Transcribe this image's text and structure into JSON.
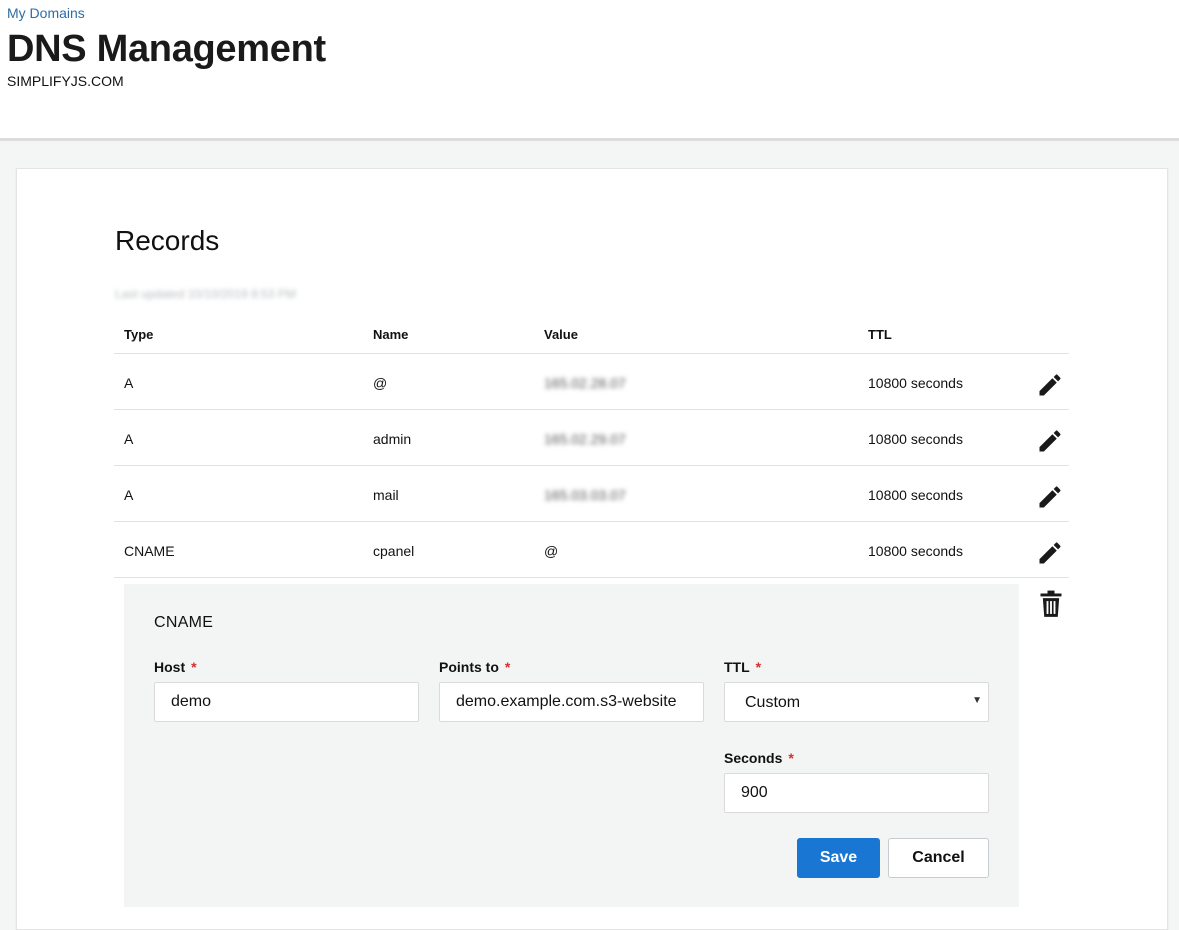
{
  "header": {
    "breadcrumb": "My Domains",
    "title": "DNS Management",
    "domain": "SIMPLIFYJS.COM"
  },
  "records": {
    "heading": "Records",
    "last_updated": "Last updated 10/10/2019 8:53 PM",
    "columns": [
      "Type",
      "Name",
      "Value",
      "TTL"
    ],
    "rows": [
      {
        "type": "A",
        "name": "@",
        "value": "165.02.28.07",
        "ttl": "10800 seconds"
      },
      {
        "type": "A",
        "name": "admin",
        "value": "165.02.29.07",
        "ttl": "10800 seconds"
      },
      {
        "type": "A",
        "name": "mail",
        "value": "165.03.03.07",
        "ttl": "10800 seconds"
      },
      {
        "type": "CNAME",
        "name": "cpanel",
        "value": "@",
        "ttl": "10800 seconds"
      }
    ]
  },
  "editor": {
    "record_type": "CNAME",
    "host_label": "Host",
    "host_value": "demo",
    "points_to_label": "Points to",
    "points_to_value": "demo.example.com.s3-website",
    "ttl_label": "TTL",
    "ttl_value": "Custom",
    "seconds_label": "Seconds",
    "seconds_value": "900",
    "required_mark": "*",
    "save_label": "Save",
    "cancel_label": "Cancel"
  },
  "icons": {
    "edit": "pencil-icon",
    "delete": "trash-icon",
    "select_caret": "caret-down-icon"
  },
  "colors": {
    "link": "#2d6ea8",
    "primary_button": "#1976d2",
    "required": "#d32f2f",
    "panel_background": "#f3f4f4"
  }
}
